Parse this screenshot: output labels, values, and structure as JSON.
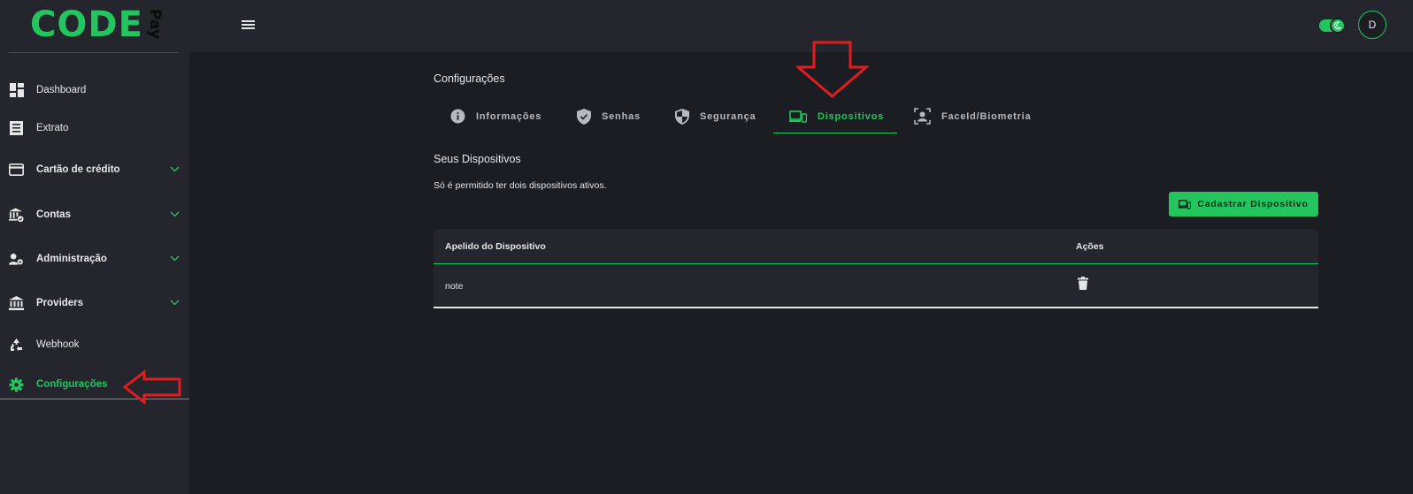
{
  "brand": {
    "name": "CODE",
    "suffix": "Pay"
  },
  "sidebar": {
    "items": [
      {
        "label": "Dashboard",
        "icon": "dashboard-icon"
      },
      {
        "label": "Extrato",
        "icon": "statement-icon"
      },
      {
        "label": "Cartão de crédito",
        "icon": "credit-card-icon",
        "expandable": true
      },
      {
        "label": "Contas",
        "icon": "bank-check-icon",
        "expandable": true
      },
      {
        "label": "Administração",
        "icon": "user-gear-icon",
        "expandable": true
      },
      {
        "label": "Providers",
        "icon": "bank-icon",
        "expandable": true
      },
      {
        "label": "Webhook",
        "icon": "recycle-icon"
      },
      {
        "label": "Configurações",
        "icon": "gear-icon",
        "active": true
      }
    ]
  },
  "topbar": {
    "menu_icon": "hamburger-icon",
    "theme_toggle": "dark-mode-toggle",
    "avatar_initial": "D"
  },
  "main": {
    "page_title": "Configurações",
    "tabs": [
      {
        "label": "Informações",
        "icon": "info-icon"
      },
      {
        "label": "Senhas",
        "icon": "shield-check-icon"
      },
      {
        "label": "Segurança",
        "icon": "shield-half-icon"
      },
      {
        "label": "Dispositivos",
        "icon": "devices-icon",
        "active": true
      },
      {
        "label": "FaceId/Biometria",
        "icon": "face-scan-icon"
      }
    ],
    "section_title": "Seus Dispositivos",
    "section_desc": "Só é permitido ter dois dispositivos ativos.",
    "add_button_label": "Cadastrar Dispositivo",
    "table": {
      "headers": [
        "Apelido do Dispositivo",
        "Ações"
      ],
      "rows": [
        {
          "nickname": "note",
          "action_icon": "trash-icon"
        }
      ]
    }
  },
  "colors": {
    "accent": "#22c55e",
    "background": "#1c1d22",
    "panel": "#25262d",
    "annotation": "#e11d1d"
  }
}
